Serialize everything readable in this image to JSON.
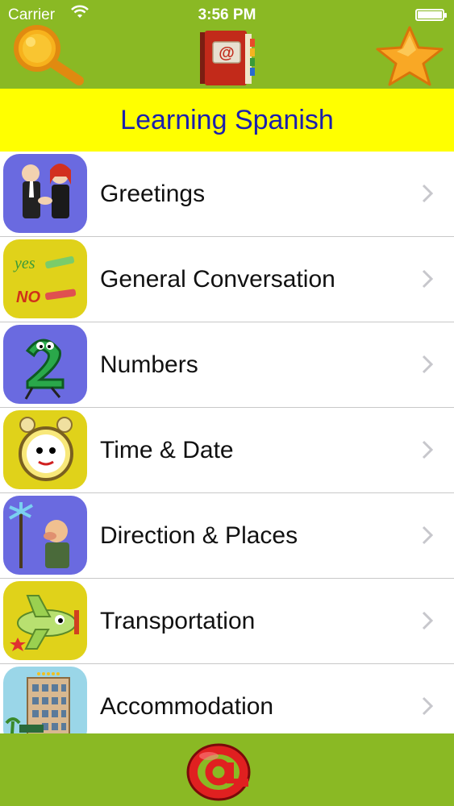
{
  "status_bar": {
    "carrier": "Carrier",
    "time": "3:56 PM"
  },
  "header": {
    "search_icon": "magnifier-icon",
    "logo_icon": "address-book-icon",
    "favorite_icon": "star-icon"
  },
  "title": "Learning Spanish",
  "categories": [
    {
      "label": "Greetings",
      "icon": "handshake-icon",
      "tile_color": "#6a6ae0"
    },
    {
      "label": "General Conversation",
      "icon": "yes-no-icon",
      "tile_color": "#e0d21a"
    },
    {
      "label": "Numbers",
      "icon": "number-two-icon",
      "tile_color": "#6a6ae0"
    },
    {
      "label": "Time & Date",
      "icon": "alarm-clock-icon",
      "tile_color": "#e0d21a"
    },
    {
      "label": "Direction & Places",
      "icon": "signpost-icon",
      "tile_color": "#6a6ae0"
    },
    {
      "label": "Transportation",
      "icon": "airplane-icon",
      "tile_color": "#e0d21a"
    },
    {
      "label": "Accommodation",
      "icon": "hotel-icon",
      "tile_color": "#9ad6e8"
    }
  ],
  "footer": {
    "at_icon": "at-sign-icon"
  },
  "colors": {
    "bar_green": "#8ab924",
    "title_band": "#ffff00",
    "title_text": "#1b1fae"
  }
}
